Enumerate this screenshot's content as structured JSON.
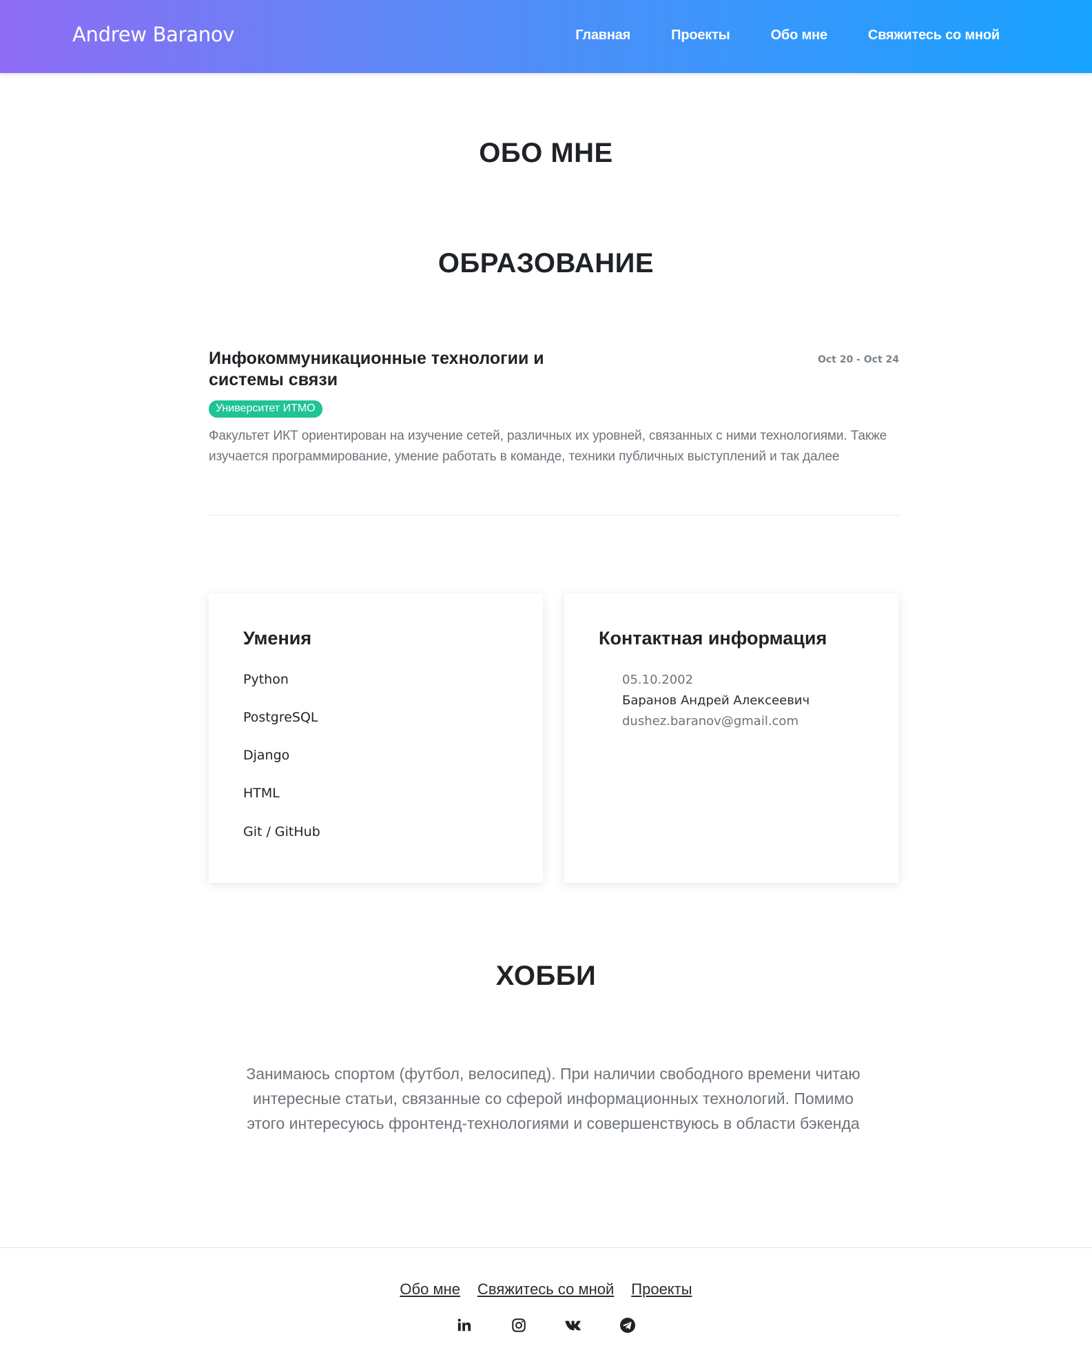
{
  "header": {
    "brand": "Andrew Baranov",
    "nav": [
      "Главная",
      "Проекты",
      "Обо мне",
      "Свяжитесь со мной"
    ]
  },
  "about": {
    "title": "ОБО МНЕ"
  },
  "education": {
    "title": "ОБРАЗОВАНИЕ",
    "degree": "Инфокоммуникационные технологии и системы связи",
    "dates": "Oct 20 - Oct 24",
    "school": "Университет ИТМО",
    "description": "Факультет ИКТ ориентирован на изучение сетей, различных их уровней, связанных с ними технологиями. Также изучается программирование, умение работать в команде, техники публичных выступлений и так далее"
  },
  "skills": {
    "title": "Умения",
    "items": [
      "Python",
      "PostgreSQL",
      "Django",
      "HTML",
      "Git / GitHub"
    ]
  },
  "contact": {
    "title": "Контактная информация",
    "birthdate": "05.10.2002",
    "full_name": "Баранов Андрей Алексеевич",
    "email": "dushez.baranov@gmail.com"
  },
  "hobby": {
    "title": "ХОББИ",
    "text": "Занимаюсь спортом (футбол, велосипед). При наличии свободного времени читаю интересные статьи, связанные со сферой информационных технологий. Помимо этого интересуюсь фронтенд-технологиями и совершенствуюсь в области бэкенда"
  },
  "footer": {
    "links": [
      "Обо мне",
      "Свяжитесь со мной",
      "Проекты"
    ],
    "socials": [
      "linkedin-icon",
      "instagram-icon",
      "vk-icon",
      "telegram-icon"
    ]
  },
  "colors": {
    "header_gradient_start": "#8f6cf4",
    "header_gradient_end": "#17a2ff",
    "badge": "#1fc494",
    "muted_text": "#6c737a"
  }
}
